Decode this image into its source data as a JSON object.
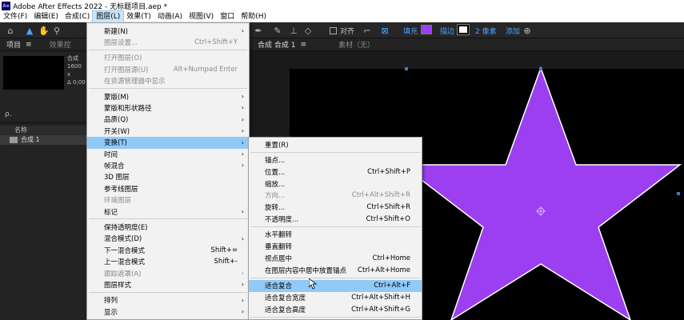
{
  "window": {
    "title": "Adobe After Effects 2022 - 无标题项目.aep *",
    "app_icon": "Ae"
  },
  "menubar": [
    {
      "label": "文件(F)"
    },
    {
      "label": "编辑(E)"
    },
    {
      "label": "合成(C)"
    },
    {
      "label": "图层(L)",
      "active": true
    },
    {
      "label": "效果(T)"
    },
    {
      "label": "动画(A)"
    },
    {
      "label": "视图(V)"
    },
    {
      "label": "窗口"
    },
    {
      "label": "帮助(H)"
    }
  ],
  "toolbar": {
    "align_label": "对齐",
    "fill_label": "填充",
    "stroke_label": "描边",
    "stroke_width": "2 像素",
    "fill_color": "#9b3ff0",
    "stroke_color": "#ffffff",
    "add_label": "添加",
    "partial_label": "效果控"
  },
  "project": {
    "tab_label": "项目",
    "comp_name": "合成",
    "comp_info_1": "1600 x",
    "comp_info_2": "Δ 0;00",
    "search_icon": "search-icon",
    "search_glyph": "ρ.",
    "col_name": "名称",
    "item_label": "合成 1"
  },
  "composition": {
    "tab_label": "合成 合成 1",
    "footage_label": "素材（无）",
    "star_color": "#9b3ff0"
  },
  "layer_menu": {
    "items": [
      {
        "label": "新建(N)",
        "arrow": true
      },
      {
        "label": "图层设置...",
        "shortcut": "Ctrl+Shift+Y",
        "disabled": true
      },
      {
        "sep": true
      },
      {
        "label": "打开图层(O)",
        "disabled": true
      },
      {
        "label": "打开图层源(U)",
        "shortcut": "Alt+Numpad Enter",
        "disabled": true
      },
      {
        "label": "在资源管理器中显示",
        "disabled": true
      },
      {
        "sep": true
      },
      {
        "label": "蒙版(M)",
        "arrow": true
      },
      {
        "label": "蒙版和形状路径",
        "arrow": true
      },
      {
        "label": "品质(Q)",
        "arrow": true
      },
      {
        "label": "开关(W)",
        "arrow": true
      },
      {
        "label": "变换(T)",
        "arrow": true,
        "highlight": true
      },
      {
        "label": "时间",
        "arrow": true
      },
      {
        "label": "帧混合",
        "arrow": true
      },
      {
        "label": "3D 图层"
      },
      {
        "label": "参考线图层"
      },
      {
        "label": "环境图层",
        "disabled": true
      },
      {
        "label": "标记",
        "arrow": true
      },
      {
        "sep": true
      },
      {
        "label": "保持透明度(E)"
      },
      {
        "label": "混合模式(D)",
        "arrow": true
      },
      {
        "label": "下一混合模式",
        "shortcut": "Shift+="
      },
      {
        "label": "上一混合模式",
        "shortcut": "Shift+-"
      },
      {
        "label": "跟踪遮罩(A)",
        "arrow": true,
        "disabled": true
      },
      {
        "label": "图层样式",
        "arrow": true
      },
      {
        "sep": true
      },
      {
        "label": "排列",
        "arrow": true
      },
      {
        "label": "显示",
        "arrow": true
      }
    ]
  },
  "transform_menu": {
    "items": [
      {
        "label": "重置(R)"
      },
      {
        "sep": true
      },
      {
        "label": "锚点..."
      },
      {
        "label": "位置...",
        "shortcut": "Ctrl+Shift+P"
      },
      {
        "label": "缩放..."
      },
      {
        "label": "方向...",
        "shortcut": "Ctrl+Alt+Shift+R",
        "disabled": true
      },
      {
        "label": "旋转...",
        "shortcut": "Ctrl+Shift+R"
      },
      {
        "label": "不透明度...",
        "shortcut": "Ctrl+Shift+O"
      },
      {
        "sep": true
      },
      {
        "label": "水平翻转"
      },
      {
        "label": "垂直翻转"
      },
      {
        "label": "视点居中",
        "shortcut": "Ctrl+Home"
      },
      {
        "label": "在图层内容中居中放置锚点",
        "shortcut": "Ctrl+Alt+Home"
      },
      {
        "sep": true
      },
      {
        "label": "适合复合",
        "shortcut": "Ctrl+Alt+F",
        "highlight": true
      },
      {
        "label": "适合复合宽度",
        "shortcut": "Ctrl+Alt+Shift+H"
      },
      {
        "label": "适合复合高度",
        "shortcut": "Ctrl+Alt+Shift+G"
      },
      {
        "sep": true
      }
    ]
  }
}
